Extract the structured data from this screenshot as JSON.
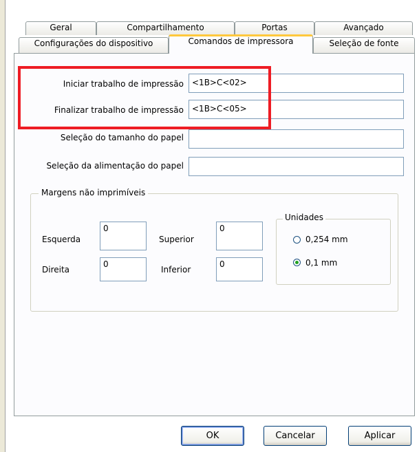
{
  "tabs": {
    "row1": [
      "Geral",
      "Compartilhamento",
      "Portas",
      "Avançado"
    ],
    "row2": [
      "Configurações do dispositivo",
      "Comandos de impressora",
      "Seleção de fonte"
    ],
    "active": "Comandos de impressora"
  },
  "commands": {
    "start_label": "Iniciar trabalho de impressão",
    "start_value": "<1B>C<02>",
    "end_label": "Finalizar trabalho de impressão",
    "end_value": "<1B>C<05>",
    "paper_size_label": "Seleção do tamanho do papel",
    "paper_size_value": "",
    "paper_feed_label": "Seleção da alimentação do papel",
    "paper_feed_value": ""
  },
  "margins": {
    "title": "Margens não imprimíveis",
    "left_label": "Esquerda",
    "left_value": "0",
    "top_label": "Superior",
    "top_value": "0",
    "right_label": "Direita",
    "right_value": "0",
    "bottom_label": "Inferior",
    "bottom_value": "0"
  },
  "units": {
    "title": "Unidades",
    "options": [
      "0,254 mm",
      "0,1 mm"
    ],
    "selected": "0,1 mm"
  },
  "buttons": {
    "ok": "OK",
    "cancel": "Cancelar",
    "apply": "Aplicar"
  },
  "colors": {
    "highlight": "#ee1c24",
    "active_tab_accent": "#ffc83c",
    "radio_checked": "#21a121"
  }
}
